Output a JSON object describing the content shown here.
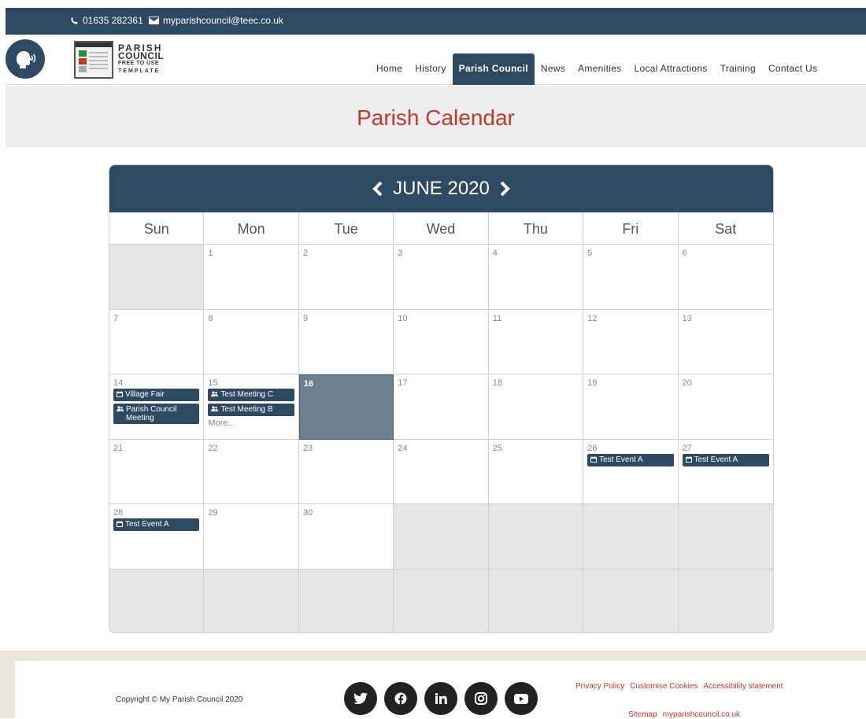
{
  "topbar": {
    "phone": "01635 282361",
    "email": "myparishcouncil@teec.co.uk"
  },
  "logo": {
    "line1": "PARISH",
    "line2": "COUNCIL",
    "line3": "FREE TO USE",
    "line4": "TEMPLATE"
  },
  "nav": {
    "items": [
      "Home",
      "History",
      "Parish Council",
      "News",
      "Amenities",
      "Local Attractions",
      "Training",
      "Contact Us"
    ],
    "active": "Parish Council"
  },
  "page": {
    "title": "Parish Calendar"
  },
  "calendar": {
    "month_label": "JUNE 2020",
    "days_of_week": [
      "Sun",
      "Mon",
      "Tue",
      "Wed",
      "Thu",
      "Fri",
      "Sat"
    ],
    "today": "16",
    "weeks": [
      [
        {
          "d": ""
        },
        {
          "d": "1"
        },
        {
          "d": "2"
        },
        {
          "d": "3"
        },
        {
          "d": "4"
        },
        {
          "d": "5"
        },
        {
          "d": "6"
        }
      ],
      [
        {
          "d": "7"
        },
        {
          "d": "8"
        },
        {
          "d": "9"
        },
        {
          "d": "10"
        },
        {
          "d": "11"
        },
        {
          "d": "12"
        },
        {
          "d": "13"
        }
      ],
      [
        {
          "d": "14",
          "events": [
            {
              "icon": "calendar-icon",
              "title": "Village Fair"
            },
            {
              "icon": "users-icon",
              "title": "Parish Council Meeting"
            }
          ]
        },
        {
          "d": "15",
          "events": [
            {
              "icon": "users-icon",
              "title": "Test Meeting C"
            },
            {
              "icon": "users-icon",
              "title": "Test Meeting B"
            }
          ],
          "more": "More..."
        },
        {
          "d": "16"
        },
        {
          "d": "17"
        },
        {
          "d": "18"
        },
        {
          "d": "19"
        },
        {
          "d": "20"
        }
      ],
      [
        {
          "d": "21"
        },
        {
          "d": "22"
        },
        {
          "d": "23"
        },
        {
          "d": "24"
        },
        {
          "d": "25"
        },
        {
          "d": "26",
          "events": [
            {
              "icon": "calendar-icon",
              "title": "Test Event A"
            }
          ]
        },
        {
          "d": "27",
          "events": [
            {
              "icon": "calendar-icon",
              "title": "Test Event A"
            }
          ]
        }
      ],
      [
        {
          "d": "28",
          "events": [
            {
              "icon": "calendar-icon",
              "title": "Test Event A"
            }
          ]
        },
        {
          "d": "29"
        },
        {
          "d": "30"
        },
        {
          "d": ""
        },
        {
          "d": ""
        },
        {
          "d": ""
        },
        {
          "d": ""
        }
      ],
      [
        {
          "d": ""
        },
        {
          "d": ""
        },
        {
          "d": ""
        },
        {
          "d": ""
        },
        {
          "d": ""
        },
        {
          "d": ""
        },
        {
          "d": ""
        }
      ]
    ]
  },
  "footer": {
    "copyright": "Copyright © My Parish Council 2020",
    "socials": [
      "twitter-icon",
      "facebook-icon",
      "linkedin-icon",
      "instagram-icon",
      "youtube-icon"
    ],
    "links_row1": [
      "Privacy Policy",
      "Customise Cookies",
      "Accessibility statement"
    ],
    "links_row2": [
      "Sitemap",
      "myparishcouncil.co.uk"
    ]
  },
  "colors": {
    "primary": "#2e4a62",
    "accent": "#c0392b",
    "today": "#6d8090",
    "empty_cell": "#e6e6e6"
  }
}
